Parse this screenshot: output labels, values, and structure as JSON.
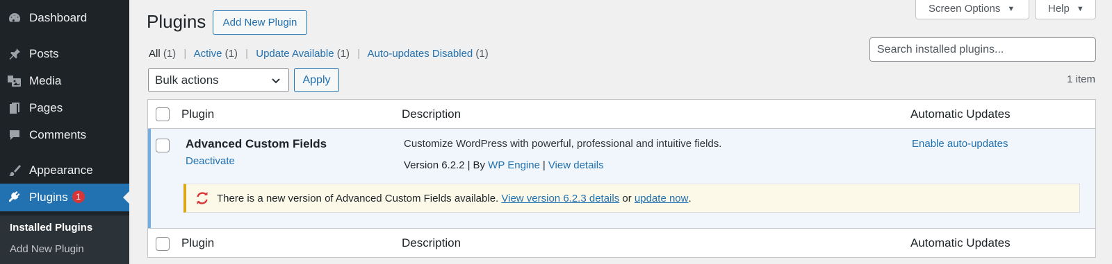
{
  "sidebar": {
    "items": [
      {
        "label": "Dashboard",
        "icon": "dashboard-icon"
      },
      {
        "label": "Posts",
        "icon": "pin-icon"
      },
      {
        "label": "Media",
        "icon": "media-icon"
      },
      {
        "label": "Pages",
        "icon": "pages-icon"
      },
      {
        "label": "Comments",
        "icon": "comment-icon"
      },
      {
        "label": "Appearance",
        "icon": "brush-icon"
      },
      {
        "label": "Plugins",
        "icon": "plugin-icon",
        "badge": "1"
      }
    ],
    "submenu": [
      "Installed Plugins",
      "Add New Plugin"
    ]
  },
  "header": {
    "title": "Plugins",
    "add_new_label": "Add New Plugin",
    "screen_options_label": "Screen Options",
    "help_label": "Help"
  },
  "filters": [
    {
      "label": "All",
      "count": "(1)"
    },
    {
      "label": "Active",
      "count": "(1)"
    },
    {
      "label": "Update Available",
      "count": "(1)"
    },
    {
      "label": "Auto-updates Disabled",
      "count": "(1)"
    }
  ],
  "search": {
    "placeholder": "Search installed plugins..."
  },
  "bulk": {
    "selected": "Bulk actions",
    "apply_label": "Apply"
  },
  "item_count": "1 item",
  "table": {
    "columns": [
      "Plugin",
      "Description",
      "Automatic Updates"
    ],
    "plugin": {
      "name": "Advanced Custom Fields",
      "action": "Deactivate",
      "description": "Customize WordPress with powerful, professional and intuitive fields.",
      "version": "Version 6.2.2",
      "by_prefix": "By",
      "author": "WP Engine",
      "details_link": "View details",
      "auto_update_link": "Enable auto-updates"
    },
    "notice": {
      "text": "There is a new version of Advanced Custom Fields available.",
      "details_link": "View version 6.2.3 details",
      "or": "or",
      "update_link": "update now",
      "end": "."
    }
  },
  "colors": {
    "accent": "#2271b1",
    "sidebar_bg": "#1d2327",
    "badge": "#d63638",
    "notice_border": "#dba617",
    "update_icon": "#d63638"
  }
}
